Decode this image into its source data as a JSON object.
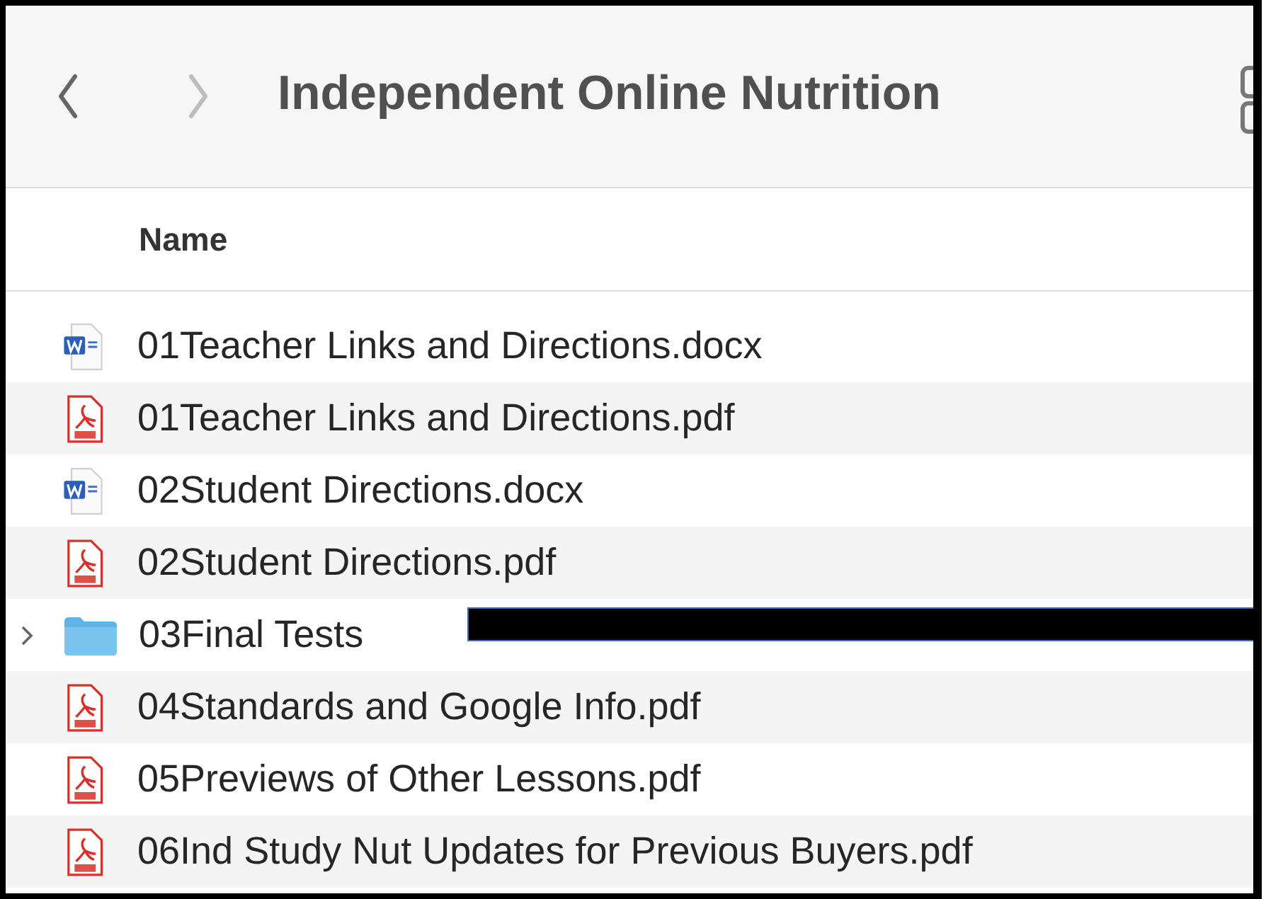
{
  "toolbar": {
    "title": "Independent Online Nutrition",
    "back": {
      "disabled": false
    },
    "forward": {
      "disabled": true
    }
  },
  "columns": [
    "Name"
  ],
  "rows": [
    {
      "kind": "docx",
      "name": "01Teacher Links and Directions.docx"
    },
    {
      "kind": "pdf",
      "name": "01Teacher Links and Directions.pdf"
    },
    {
      "kind": "docx",
      "name": "02Student Directions.docx"
    },
    {
      "kind": "pdf",
      "name": "02Student Directions.pdf"
    },
    {
      "kind": "folder",
      "name": "03Final Tests",
      "expanded": false
    },
    {
      "kind": "pdf",
      "name": "04Standards and Google Info.pdf"
    },
    {
      "kind": "pdf",
      "name": "05Previews of Other Lessons.pdf"
    },
    {
      "kind": "pdf",
      "name": "06Ind Study Nut Updates for Previous Buyers.pdf"
    }
  ]
}
